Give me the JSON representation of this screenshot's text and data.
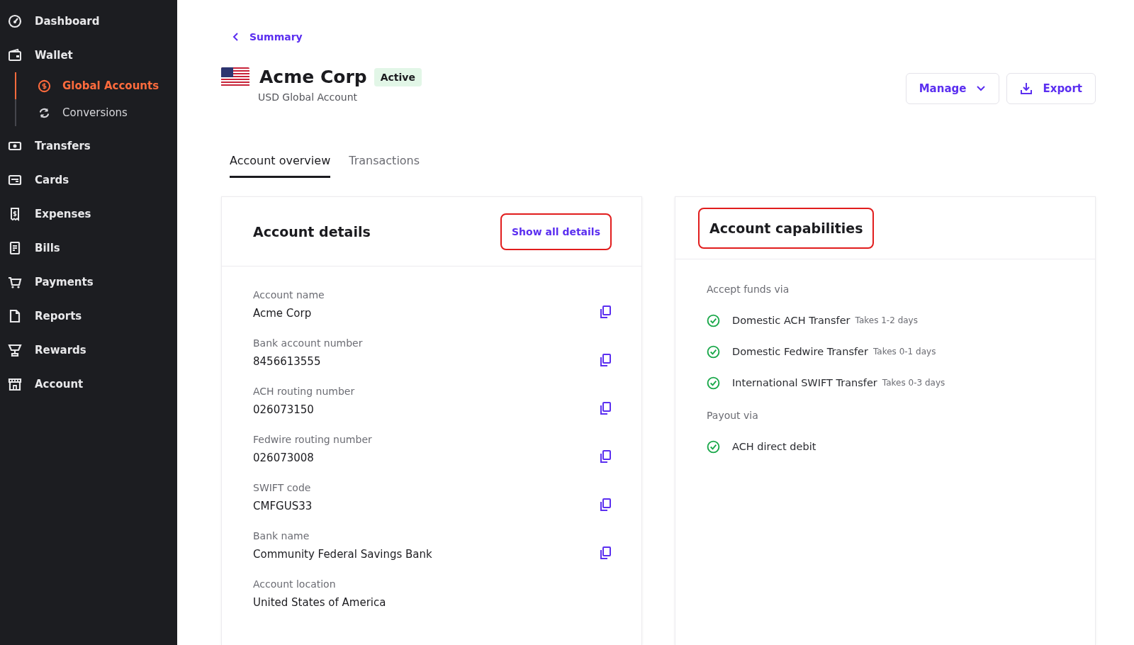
{
  "sidebar": {
    "items": [
      {
        "label": "Dashboard",
        "kind": "gauge",
        "selected": false
      },
      {
        "label": "Wallet",
        "kind": "wallet",
        "selected": false,
        "children": [
          {
            "label": "Global Accounts",
            "kind": "coin",
            "selected": true
          },
          {
            "label": "Conversions",
            "kind": "sync",
            "selected": false
          }
        ]
      },
      {
        "label": "Transfers",
        "kind": "cash",
        "selected": false
      },
      {
        "label": "Cards",
        "kind": "card",
        "selected": false
      },
      {
        "label": "Expenses",
        "kind": "receipt",
        "selected": false
      },
      {
        "label": "Bills",
        "kind": "bill",
        "selected": false
      },
      {
        "label": "Payments",
        "kind": "cart",
        "selected": false
      },
      {
        "label": "Reports",
        "kind": "doc",
        "selected": false
      },
      {
        "label": "Rewards",
        "kind": "trophy",
        "selected": false
      },
      {
        "label": "Account",
        "kind": "store",
        "selected": false
      }
    ]
  },
  "back_link": "Summary",
  "header": {
    "title": "Acme Corp",
    "status": "Active",
    "subtitle": "USD Global Account",
    "actions": [
      {
        "label": "Manage",
        "kind": "dropdown"
      },
      {
        "label": "Export",
        "kind": "download"
      }
    ]
  },
  "tabs": [
    {
      "label": "Account overview",
      "selected": true
    },
    {
      "label": "Transactions",
      "selected": false
    }
  ],
  "details_card": {
    "title": "Account details",
    "action": "Show all details",
    "action_highlighted": true,
    "fields": [
      {
        "label": "Account name",
        "value": "Acme Corp",
        "copyable": true
      },
      {
        "label": "Bank account number",
        "value": "8456613555",
        "copyable": true
      },
      {
        "label": "ACH routing number",
        "value": "026073150",
        "copyable": true
      },
      {
        "label": "Fedwire routing number",
        "value": "026073008",
        "copyable": true
      },
      {
        "label": "SWIFT code",
        "value": "CMFGUS33",
        "copyable": true
      },
      {
        "label": "Bank name",
        "value": "Community Federal Savings Bank",
        "copyable": true
      },
      {
        "label": "Account location",
        "value": "United States of America",
        "copyable": false
      }
    ]
  },
  "capabilities_card": {
    "title": "Account capabilities",
    "title_highlighted": true,
    "groups": [
      {
        "heading": "Accept funds via",
        "items": [
          {
            "name": "Domestic ACH Transfer",
            "note": "Takes 1-2 days",
            "enabled": true
          },
          {
            "name": "Domestic Fedwire Transfer",
            "note": "Takes 0-1 days",
            "enabled": true
          },
          {
            "name": "International SWIFT Transfer",
            "note": "Takes 0-3 days",
            "enabled": true
          }
        ]
      },
      {
        "heading": "Payout via",
        "items": [
          {
            "name": "ACH direct debit",
            "enabled": true
          }
        ]
      }
    ]
  }
}
